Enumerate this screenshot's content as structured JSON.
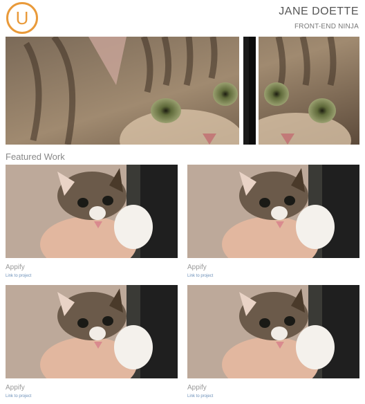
{
  "header": {
    "logo_letter": "U",
    "name": "JANE DOETTE",
    "title": "FRONT-END NINJA",
    "accent_color": "#e99a3a"
  },
  "section": {
    "heading": "Featured Work"
  },
  "projects": [
    {
      "name": "Appify",
      "link": "Link to project"
    },
    {
      "name": "Appify",
      "link": "Link to project"
    },
    {
      "name": "Appify",
      "link": "Link to project"
    },
    {
      "name": "Appify",
      "link": "Link to project"
    }
  ]
}
